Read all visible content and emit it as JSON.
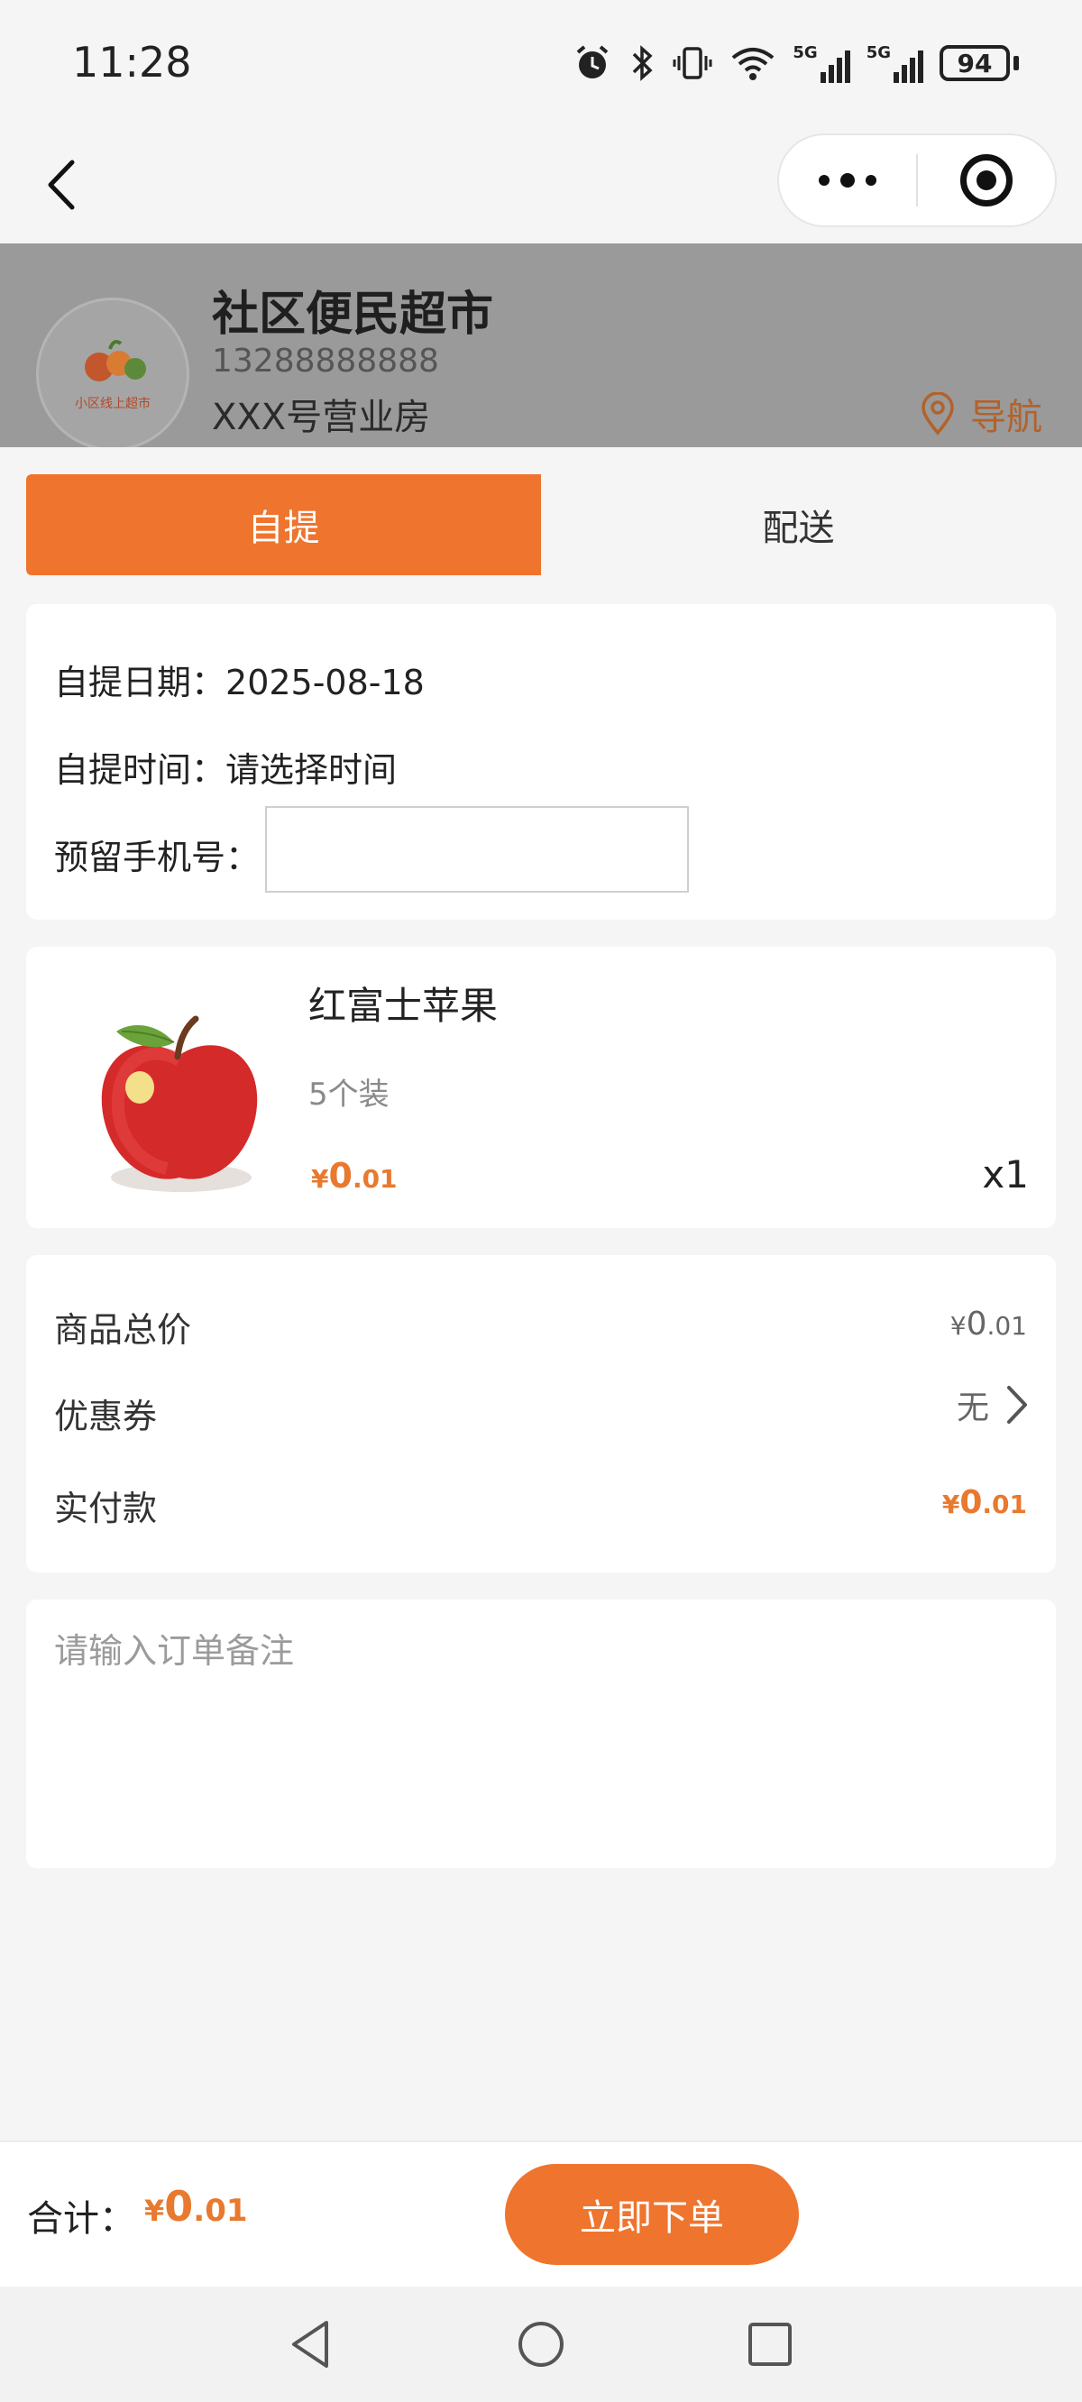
{
  "status_bar": {
    "time": "11:28",
    "battery": "94",
    "network_1": "5G",
    "network_2": "5G"
  },
  "store": {
    "name": "社区便民超市",
    "phone": "13288888888",
    "address": "XXX号营业房",
    "navigate_label": "导航",
    "logo_text": "小区线上超市"
  },
  "tabs": [
    {
      "label": "自提",
      "active": true
    },
    {
      "label": "配送",
      "active": false
    }
  ],
  "pickup": {
    "date_label": "自提日期：",
    "date_value": "2025-08-18",
    "time_label": "自提时间：",
    "time_value": "请选择时间",
    "phone_label": "预留手机号：",
    "phone_value": ""
  },
  "product": {
    "name": "红富士苹果",
    "spec": "5个装",
    "price_symbol": "¥",
    "price_int": "0",
    "price_dec": ".01",
    "quantity": "x1"
  },
  "summary": {
    "total_label": "商品总价",
    "total_symbol": "¥",
    "total_int": "0",
    "total_dec": ".01",
    "coupon_label": "优惠券",
    "coupon_value": "无",
    "paid_label": "实付款",
    "paid_symbol": "¥",
    "paid_int": "0",
    "paid_dec": ".01"
  },
  "remark": {
    "placeholder": "请输入订单备注"
  },
  "bottom_bar": {
    "total_label": "合计：",
    "total_symbol": "¥",
    "total_int": "0",
    "total_dec": ".01",
    "submit_label": "立即下单"
  },
  "colors": {
    "accent": "#ef742d",
    "price": "#e8792e",
    "background": "#f5f5f5"
  }
}
